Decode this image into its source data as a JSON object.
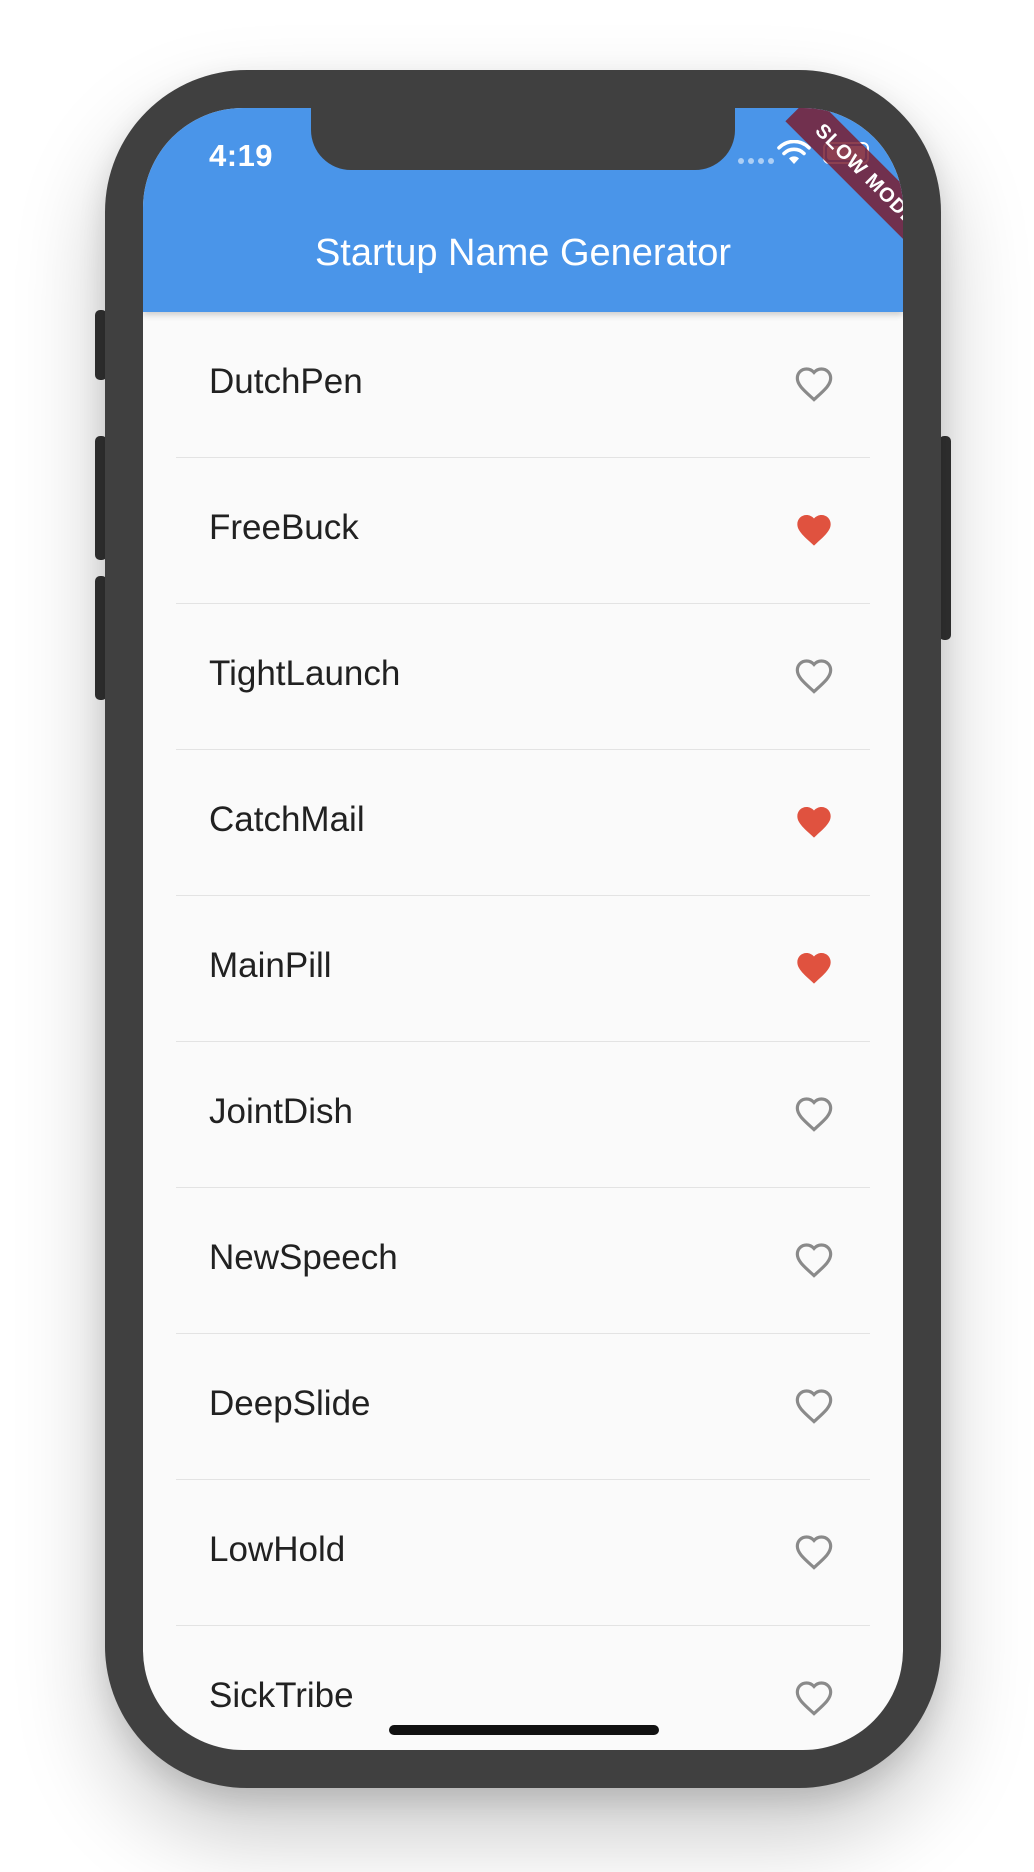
{
  "status_bar": {
    "time": "4:19",
    "wifi_icon": "wifi-icon",
    "battery_icon": "battery-icon"
  },
  "debug_banner": {
    "label": "SLOW MODE"
  },
  "appbar": {
    "title": "Startup Name Generator",
    "color": "#4a95e9"
  },
  "colors": {
    "favorite": "#e0523f",
    "not_favorite": "#8a8a8a"
  },
  "list": {
    "items": [
      {
        "name": "DutchPen",
        "favorite": false
      },
      {
        "name": "FreeBuck",
        "favorite": true
      },
      {
        "name": "TightLaunch",
        "favorite": false
      },
      {
        "name": "CatchMail",
        "favorite": true
      },
      {
        "name": "MainPill",
        "favorite": true
      },
      {
        "name": "JointDish",
        "favorite": false
      },
      {
        "name": "NewSpeech",
        "favorite": false
      },
      {
        "name": "DeepSlide",
        "favorite": false
      },
      {
        "name": "LowHold",
        "favorite": false
      },
      {
        "name": "SickTribe",
        "favorite": false
      }
    ]
  }
}
